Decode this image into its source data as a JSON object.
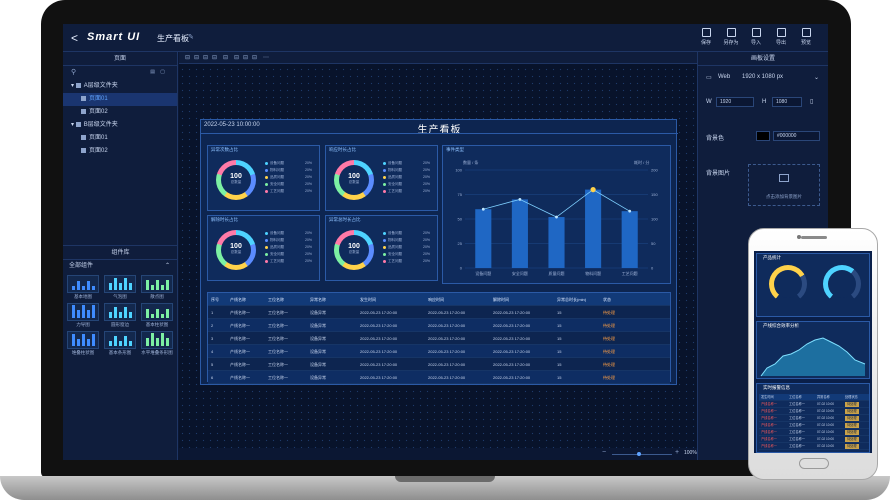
{
  "topbar": {
    "back": "<",
    "logo": "Smart UI",
    "page_title": "生产看板",
    "edit_icon": "edit-icon",
    "tools": [
      {
        "label": "保存",
        "icon": "save-icon"
      },
      {
        "label": "另存为",
        "icon": "save-as-icon"
      },
      {
        "label": "导入",
        "icon": "import-icon"
      },
      {
        "label": "导出",
        "icon": "export-icon"
      },
      {
        "label": "预览",
        "icon": "preview-icon"
      }
    ]
  },
  "left_panel": {
    "pages_title": "页面",
    "tree": [
      {
        "label": "A层级文件夹",
        "child": false,
        "selected": false
      },
      {
        "label": "页面01",
        "child": true,
        "selected": true
      },
      {
        "label": "页面02",
        "child": true,
        "selected": false
      },
      {
        "label": "B层级文件夹",
        "child": false,
        "selected": false
      },
      {
        "label": "页面01",
        "child": true,
        "selected": false
      },
      {
        "label": "页面02",
        "child": true,
        "selected": false
      }
    ],
    "library_title": "组件库",
    "all_components": "全部组件",
    "components": [
      {
        "label": "基本地图"
      },
      {
        "label": "气泡图"
      },
      {
        "label": "散点图"
      },
      {
        "label": "力导图"
      },
      {
        "label": "圆形窗边"
      },
      {
        "label": "基本柱状图"
      },
      {
        "label": "堆叠柱状图"
      },
      {
        "label": "基本条形图"
      },
      {
        "label": "水平堆叠条形图"
      }
    ]
  },
  "canvas": {
    "zoom": "100%",
    "minus": "−",
    "plus": "+"
  },
  "dashboard": {
    "date": "2022-05-23  10:00:00",
    "title": "生产看板",
    "panels": [
      {
        "title": "异常次数占比",
        "value": "100",
        "unit": "总数量"
      },
      {
        "title": "响应时长占比",
        "value": "100",
        "unit": "总数量"
      },
      {
        "title": "解除时长占比",
        "value": "100",
        "unit": "总数量"
      },
      {
        "title": "异常总时长占比",
        "value": "100",
        "unit": "总数量"
      }
    ],
    "legend": [
      {
        "name": "设备问题",
        "value": "20%",
        "color": "#4ed3ff"
      },
      {
        "name": "物料问题",
        "value": "20%",
        "color": "#5b8cff"
      },
      {
        "name": "品质问题",
        "value": "20%",
        "color": "#ffd24a"
      },
      {
        "name": "安全问题",
        "value": "20%",
        "color": "#7cf0a3"
      },
      {
        "name": "工艺问题",
        "value": "20%",
        "color": "#ff7aa8"
      }
    ],
    "event_chart_title": "事件类型",
    "table": {
      "headers": [
        "序号",
        "产线名称",
        "工位名称",
        "异常名称",
        "发生时间",
        "响应时间",
        "解除时间",
        "异常总时长(min)",
        "状态"
      ],
      "rows": [
        [
          "1",
          "产线名称一",
          "工位名称一",
          "设备异常",
          "2022-05-23  17:20:00",
          "2022-05-23  17:20:00",
          "2022-05-23  17:20:00",
          "15",
          "待处理"
        ],
        [
          "2",
          "产线名称一",
          "工位名称一",
          "设备异常",
          "2022-05-23  17:20:00",
          "2022-05-23  17:20:00",
          "2022-05-23  17:20:00",
          "15",
          "待处理"
        ],
        [
          "3",
          "产线名称一",
          "工位名称一",
          "设备异常",
          "2022-05-23  17:20:00",
          "2022-05-23  17:20:00",
          "2022-05-23  17:20:00",
          "15",
          "待处理"
        ],
        [
          "4",
          "产线名称一",
          "工位名称一",
          "设备异常",
          "2022-05-23  17:20:00",
          "2022-05-23  17:20:00",
          "2022-05-23  17:20:00",
          "15",
          "待处理"
        ],
        [
          "5",
          "产线名称一",
          "工位名称一",
          "设备异常",
          "2022-05-23  17:20:00",
          "2022-05-23  17:20:00",
          "2022-05-23  17:20:00",
          "15",
          "待处理"
        ],
        [
          "6",
          "产线名称一",
          "工位名称一",
          "设备异常",
          "2022-05-23  17:20:00",
          "2022-05-23  17:20:00",
          "2022-05-23  17:20:00",
          "15",
          "待处理"
        ]
      ]
    }
  },
  "chart_data": {
    "type": "bar",
    "title": "事件类型",
    "ylabel": "数量 / 条",
    "y2label": "耗时 / 分",
    "categories": [
      "设备问题",
      "安全问题",
      "质量问题",
      "物料问题",
      "工艺问题"
    ],
    "series": [
      {
        "type": "bar",
        "values": [
          60,
          70,
          52,
          80,
          58
        ]
      },
      {
        "type": "line",
        "values": [
          60,
          70,
          52,
          80,
          58
        ]
      }
    ],
    "ylim": [
      0,
      100
    ],
    "yticks": [
      "0",
      "25",
      "50",
      "75",
      "100"
    ],
    "y2ticks": [
      "0",
      "50",
      "100",
      "150",
      "200"
    ]
  },
  "right_panel": {
    "title": "画板设置",
    "device_label": "Web",
    "device_value": "1920 x 1080 px",
    "w_label": "W",
    "w_value": "1920",
    "h_label": "H",
    "h_value": "1080",
    "bg_color_label": "背景色",
    "bg_color_value": "#000000",
    "bg_image_label": "背景图片",
    "upload_text": "点击添加背景图片"
  },
  "phone": {
    "card1_title": "产品统计",
    "card2_title": "产线综合效率分析",
    "card3_title": "实时报警信息",
    "table_rows": [
      [
        "发生时间",
        "工位名称",
        "异常名称",
        "处理状态"
      ],
      [
        "产线名称一",
        "工位名称一",
        "07-02 10:00",
        "待处理"
      ],
      [
        "产线名称一",
        "工位名称一",
        "07-02 10:00",
        "待处理"
      ],
      [
        "产线名称一",
        "工位名称一",
        "07-02 10:00",
        "待处理"
      ],
      [
        "产线名称一",
        "工位名称一",
        "07-02 10:00",
        "待处理"
      ],
      [
        "产线名称一",
        "工位名称一",
        "07-02 10:00",
        "待处理"
      ],
      [
        "产线名称一",
        "工位名称一",
        "07-02 10:00",
        "待处理"
      ],
      [
        "产线名称一",
        "工位名称一",
        "07-02 10:00",
        "待处理"
      ]
    ]
  }
}
